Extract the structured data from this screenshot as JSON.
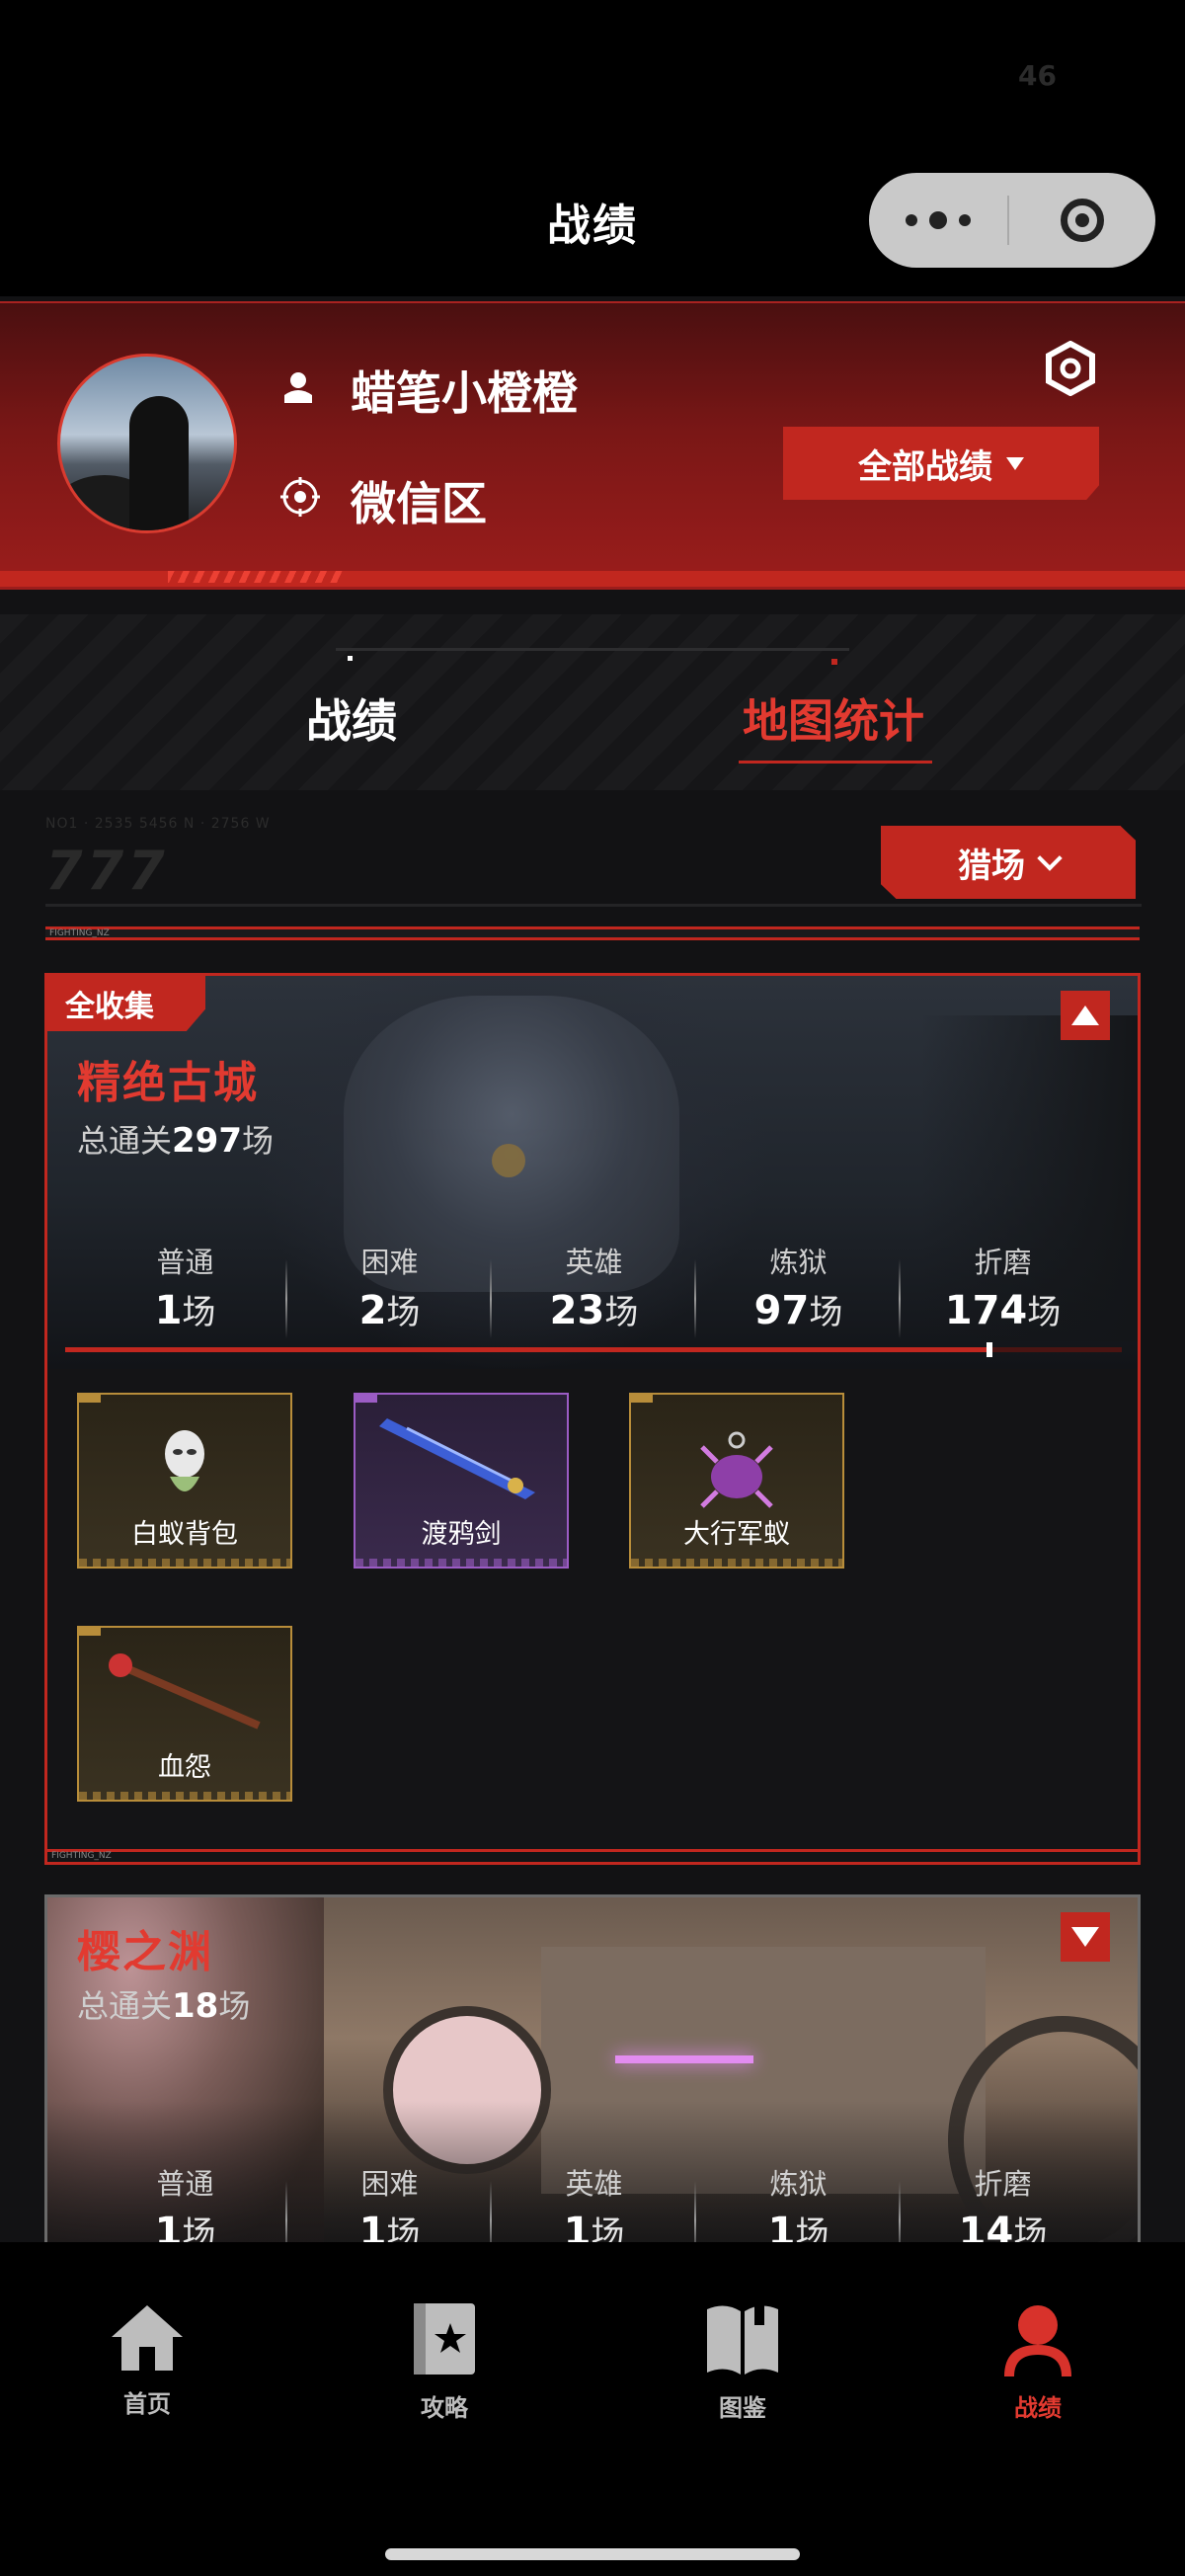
{
  "status": {
    "number": "46"
  },
  "nav": {
    "title": "战绩"
  },
  "profile": {
    "user_name": "蜡笔小橙橙",
    "zone": "微信区",
    "all_records_label": "全部战绩"
  },
  "tabs": [
    {
      "label": "战绩",
      "active": false
    },
    {
      "label": "地图统计",
      "active": true
    }
  ],
  "filter": {
    "ghost_text": "NO1 · 2535 5456 N · 2756 W",
    "ghost_big": "777",
    "mode_label": "猎场"
  },
  "separator_label": "FIGHTING_NZ",
  "maps": [
    {
      "badge": "全收集",
      "name": "精绝古城",
      "total_prefix": "总通关",
      "total": "297",
      "unit": "场",
      "expanded": true,
      "progress": 0.875,
      "stats": [
        {
          "label": "普通",
          "value": "1"
        },
        {
          "label": "困难",
          "value": "2"
        },
        {
          "label": "英雄",
          "value": "23"
        },
        {
          "label": "炼狱",
          "value": "97"
        },
        {
          "label": "折磨",
          "value": "174"
        }
      ],
      "items": [
        {
          "name": "白蚁背包",
          "rarity": "gold"
        },
        {
          "name": "渡鸦剑",
          "rarity": "purple"
        },
        {
          "name": "大行军蚁",
          "rarity": "gold"
        },
        {
          "name": "血怨",
          "rarity": "gold"
        }
      ]
    },
    {
      "name": "樱之渊",
      "total_prefix": "总通关",
      "total": "18",
      "unit": "场",
      "expanded": false,
      "stats": [
        {
          "label": "普通",
          "value": "1"
        },
        {
          "label": "困难",
          "value": "1"
        },
        {
          "label": "英雄",
          "value": "1"
        },
        {
          "label": "炼狱",
          "value": "1"
        },
        {
          "label": "折磨",
          "value": "14"
        }
      ]
    }
  ],
  "tabbar": [
    {
      "label": "首页",
      "icon": "home-icon",
      "active": false
    },
    {
      "label": "攻略",
      "icon": "guide-book-icon",
      "active": false
    },
    {
      "label": "图鉴",
      "icon": "open-book-icon",
      "active": false
    },
    {
      "label": "战绩",
      "icon": "profile-icon",
      "active": true
    }
  ],
  "colors": {
    "accent": "#c1271f",
    "accent_text": "#e23a30",
    "gold": "#b88d3a",
    "purple": "#9b5cc4"
  }
}
